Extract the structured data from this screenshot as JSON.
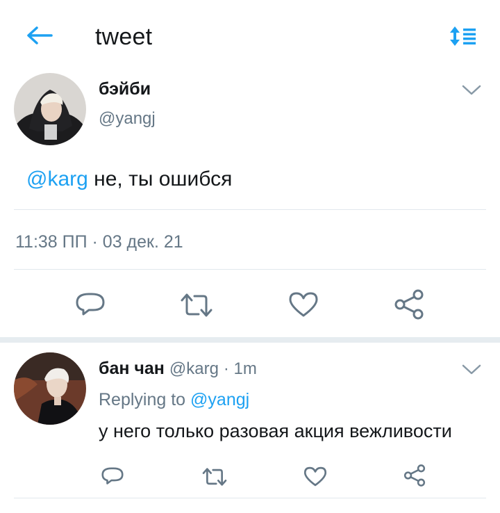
{
  "header": {
    "title": "tweet",
    "back_icon": "arrow-left-icon",
    "sort_icon": "sort-timeline-icon"
  },
  "colors": {
    "accent": "#1da1f2",
    "text": "#14171a",
    "muted": "#657786",
    "icon": "#657786"
  },
  "main_tweet": {
    "display_name": "бэйби",
    "handle": "@yangj",
    "mention": "@karg",
    "text": "не, ты ошибся",
    "timestamp": "11:38 ПП · 03 дек. 21"
  },
  "reply": {
    "display_name": "бан чан",
    "handle": "@karg",
    "time": "· 1m",
    "replying_prefix": "Replying to",
    "replying_to": "@yangj",
    "text": "у него только разовая акция вежливости"
  }
}
